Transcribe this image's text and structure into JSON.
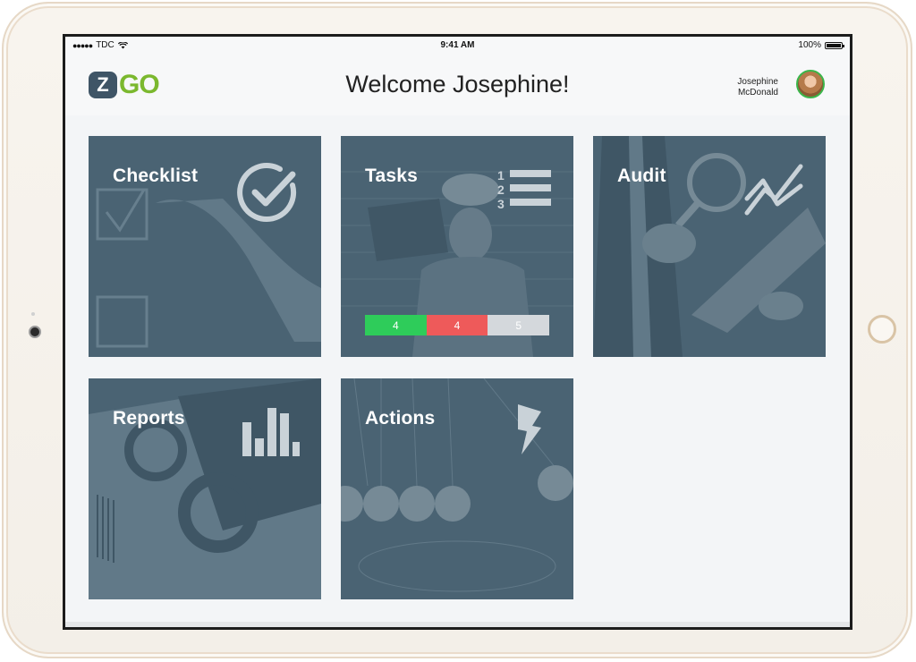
{
  "status_bar": {
    "carrier": "TDC",
    "time": "9:41 AM",
    "battery": "100%"
  },
  "header": {
    "logo_mark": "Z",
    "logo_text": "GO",
    "welcome": "Welcome Josephine!",
    "user_first": "Josephine",
    "user_last": "McDonald"
  },
  "tiles": [
    {
      "label": "Checklist",
      "icon": "check-circle-icon"
    },
    {
      "label": "Tasks",
      "icon": "numbered-list-icon"
    },
    {
      "label": "Audit",
      "icon": "trend-chart-icon"
    },
    {
      "label": "Reports",
      "icon": "bar-chart-icon"
    },
    {
      "label": "Actions",
      "icon": "lightning-icon"
    }
  ],
  "task_counters": [
    {
      "value": "4",
      "color": "#2ecc5a"
    },
    {
      "value": "4",
      "color": "#ee5a5a"
    },
    {
      "value": "5",
      "color": "#d4d8dc"
    }
  ],
  "colors": {
    "tile_bg": "#4a6373",
    "brand_green": "#7bb82e",
    "brand_dark": "#3f5566"
  }
}
